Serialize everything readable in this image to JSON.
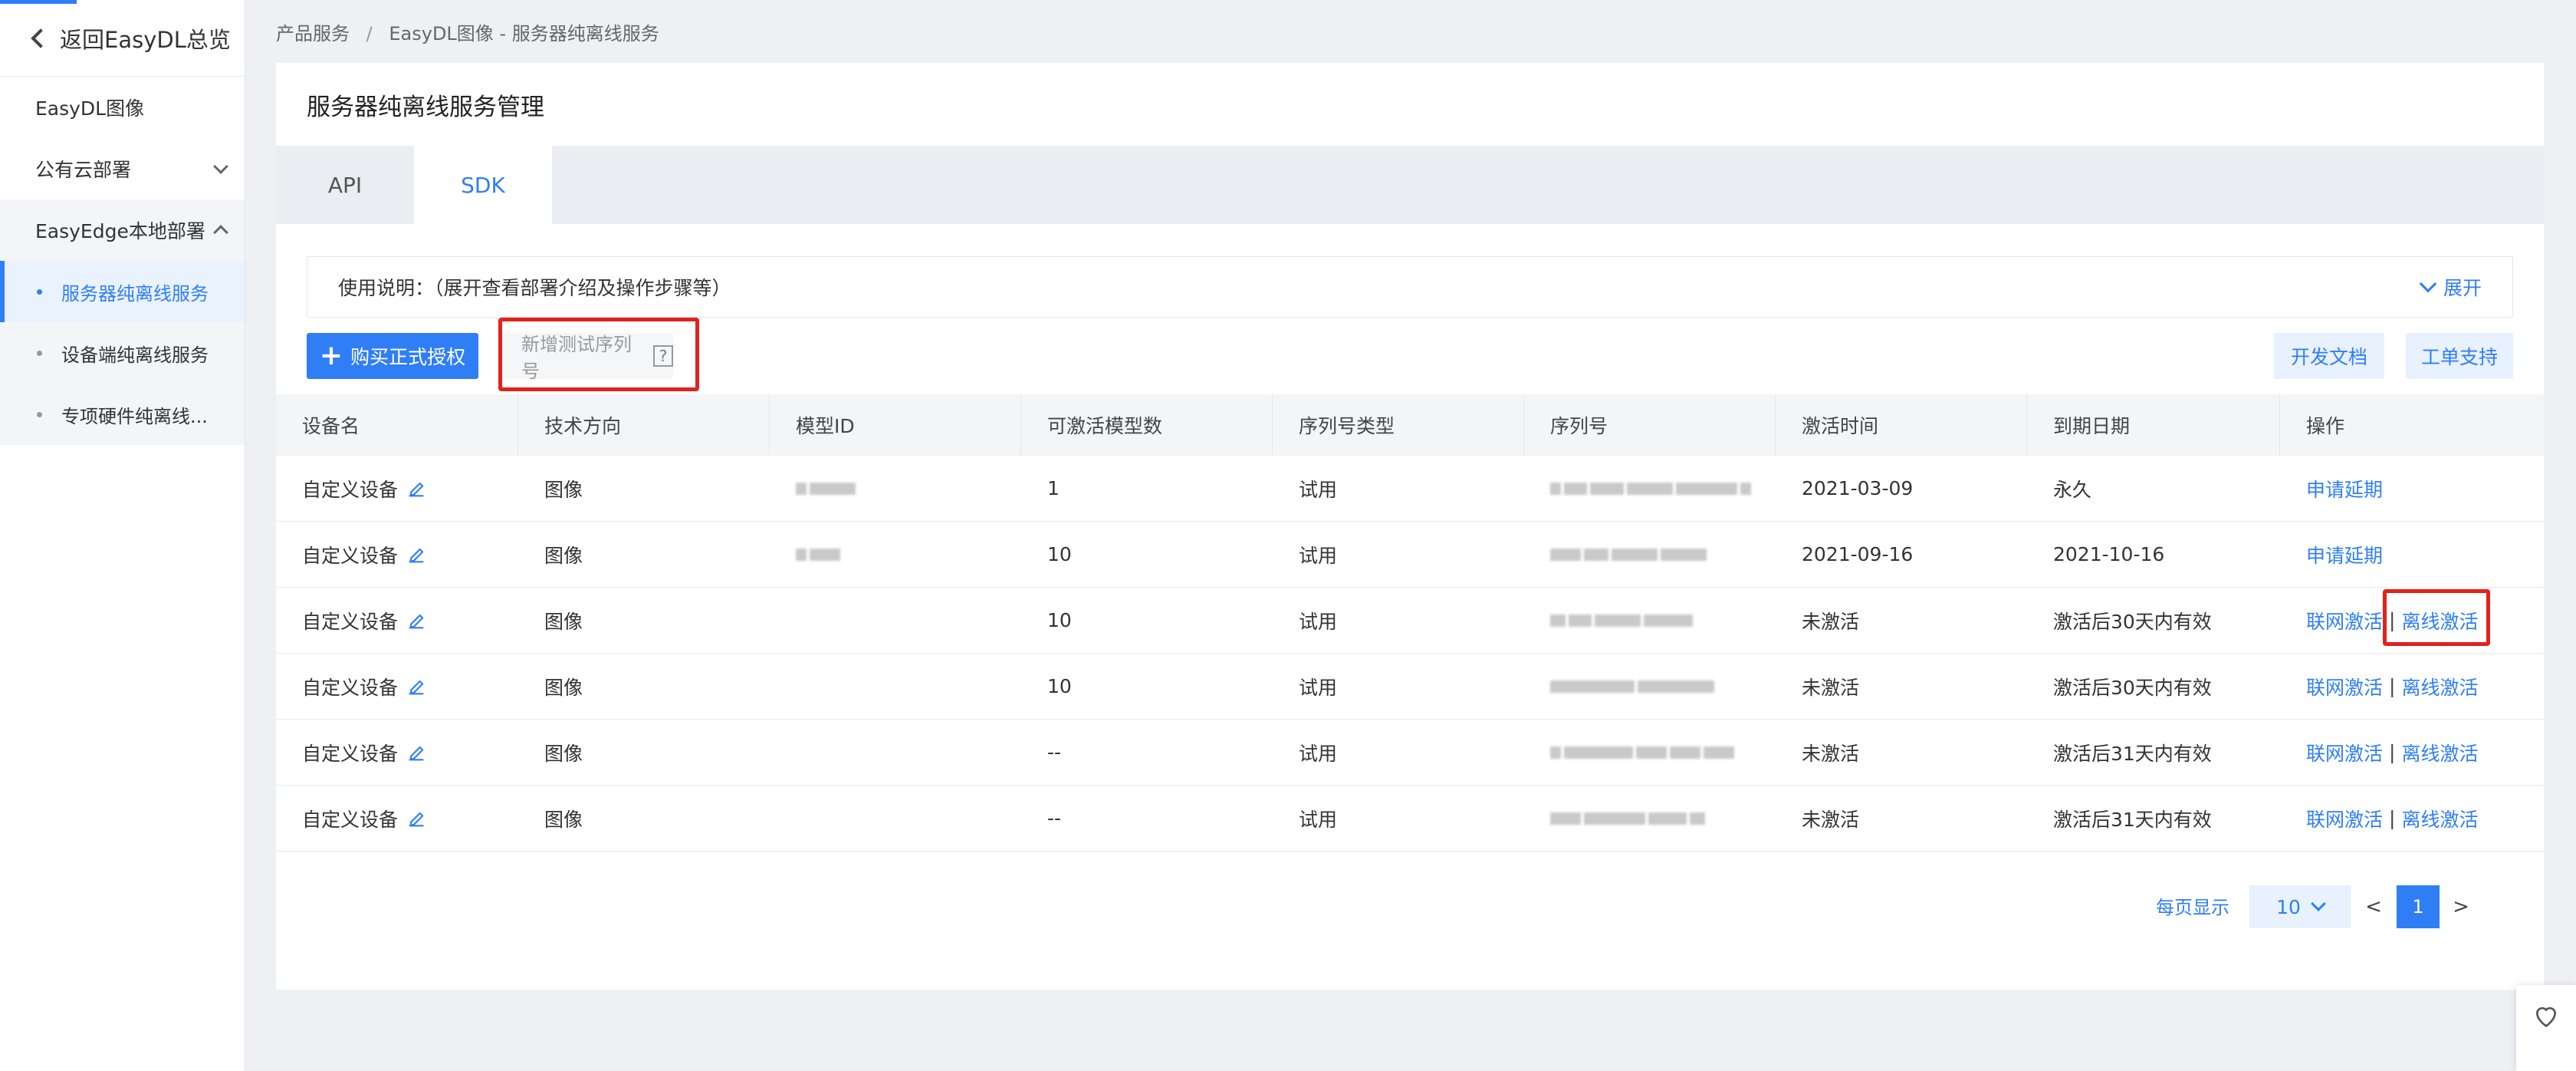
{
  "sidebar": {
    "back_label": "返回EasyDL总览",
    "items": [
      {
        "label": "EasyDL图像"
      },
      {
        "label": "公有云部署"
      },
      {
        "label": "EasyEdge本地部署"
      }
    ],
    "sub_items": [
      {
        "label": "服务器纯离线服务"
      },
      {
        "label": "设备端纯离线服务"
      },
      {
        "label": "专项硬件纯离线..."
      }
    ]
  },
  "breadcrumb": {
    "items": [
      "产品服务",
      "EasyDL图像 - 服务器纯离线服务"
    ],
    "separator": "/"
  },
  "page": {
    "title": "服务器纯离线服务管理",
    "tabs": [
      {
        "label": "API"
      },
      {
        "label": "SDK"
      }
    ],
    "active_tab": "SDK"
  },
  "usage": {
    "text": "使用说明：（展开查看部署介绍及操作步骤等）",
    "expand_label": "展开"
  },
  "toolbar": {
    "buy_label": "购买正式授权",
    "test_label": "新增测试序列号",
    "test_help": "?",
    "dev_docs_label": "开发文档",
    "ticket_label": "工单支持"
  },
  "table": {
    "columns": [
      "设备名",
      "技术方向",
      "模型ID",
      "可激活模型数",
      "序列号类型",
      "序列号",
      "激活时间",
      "到期日期",
      "操作"
    ],
    "rows": [
      {
        "device": "自定义设备",
        "direction": "图像",
        "models": "1",
        "type": "试用",
        "activated": "2021-03-09",
        "expiry": "永久",
        "actions": [
          "申请延期"
        ]
      },
      {
        "device": "自定义设备",
        "direction": "图像",
        "models": "10",
        "type": "试用",
        "activated": "2021-09-16",
        "expiry": "2021-10-16",
        "actions": [
          "申请延期"
        ]
      },
      {
        "device": "自定义设备",
        "direction": "图像",
        "models": "10",
        "type": "试用",
        "activated": "未激活",
        "expiry": "激活后30天内有效",
        "actions": [
          "联网激活",
          "离线激活"
        ]
      },
      {
        "device": "自定义设备",
        "direction": "图像",
        "models": "10",
        "type": "试用",
        "activated": "未激活",
        "expiry": "激活后30天内有效",
        "actions": [
          "联网激活",
          "离线激活"
        ]
      },
      {
        "device": "自定义设备",
        "direction": "图像",
        "models": "--",
        "type": "试用",
        "activated": "未激活",
        "expiry": "激活后31天内有效",
        "actions": [
          "联网激活",
          "离线激活"
        ]
      },
      {
        "device": "自定义设备",
        "direction": "图像",
        "models": "--",
        "type": "试用",
        "activated": "未激活",
        "expiry": "激活后31天内有效",
        "actions": [
          "联网激活",
          "离线激活"
        ]
      }
    ]
  },
  "pagination": {
    "per_page_label": "每页显示",
    "page_size": "10",
    "prev": "<",
    "next": ">",
    "current_page": "1"
  },
  "colors": {
    "accent": "#2f7ef5",
    "highlight": "#e0231d"
  }
}
